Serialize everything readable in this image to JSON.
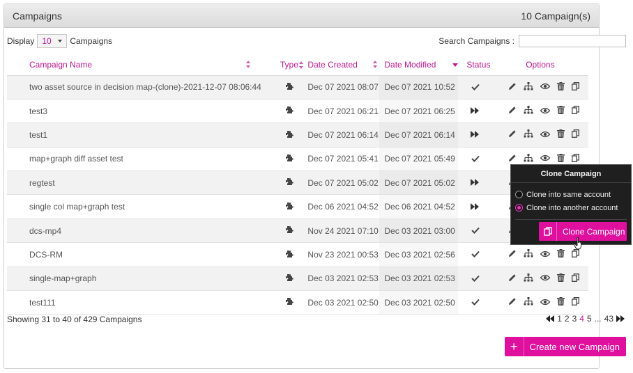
{
  "panel": {
    "title": "Campaigns",
    "count_label": "10 Campaign(s)"
  },
  "toolbar": {
    "display_label": "Display",
    "page_size": "10",
    "campaigns_label": "Campaigns",
    "search_label": "Search Campaigns :",
    "search_value": ""
  },
  "columns": {
    "name": "Campaign Name",
    "type": "Type",
    "date_created": "Date Created",
    "date_modified": "Date Modified",
    "status": "Status",
    "options": "Options"
  },
  "rows": [
    {
      "name": "two asset source in decision map-(clone)-2021-12-07 08:06:44",
      "created": "Dec 07 2021 08:07",
      "modified": "Dec 07 2021 10:52",
      "status": "check-icon"
    },
    {
      "name": "test3",
      "created": "Dec 07 2021 06:21",
      "modified": "Dec 07 2021 06:25",
      "status": "fast-forward-icon"
    },
    {
      "name": "test1",
      "created": "Dec 07 2021 06:14",
      "modified": "Dec 07 2021 06:14",
      "status": "fast-forward-icon"
    },
    {
      "name": "map+graph diff asset test",
      "created": "Dec 07 2021 05:41",
      "modified": "Dec 07 2021 05:49",
      "status": "check-icon"
    },
    {
      "name": "regtest",
      "created": "Dec 07 2021 05:02",
      "modified": "Dec 07 2021 05:02",
      "status": "fast-forward-icon"
    },
    {
      "name": "single col map+graph test",
      "created": "Dec 06 2021 04:52",
      "modified": "Dec 06 2021 04:52",
      "status": "fast-forward-icon"
    },
    {
      "name": "dcs-mp4",
      "created": "Nov 24 2021 07:10",
      "modified": "Dec 03 2021 03:00",
      "status": "check-icon"
    },
    {
      "name": "DCS-RM",
      "created": "Nov 23 2021 00:53",
      "modified": "Dec 03 2021 02:56",
      "status": "check-icon"
    },
    {
      "name": "single-map+graph",
      "created": "Dec 03 2021 02:53",
      "modified": "Dec 03 2021 02:53",
      "status": "check-icon"
    },
    {
      "name": "test111",
      "created": "Dec 03 2021 02:50",
      "modified": "Dec 03 2021 02:50",
      "status": "check-icon"
    }
  ],
  "footer": {
    "showing": "Showing 31 to 40 of 429 Campaigns"
  },
  "pagination": {
    "pages": [
      "1",
      "2",
      "3",
      "4",
      "5"
    ],
    "active": "4",
    "ellipsis": "...",
    "last": "43"
  },
  "create_button": {
    "label": "Create new Campaign"
  },
  "clone_popover": {
    "title": "Clone Campaign",
    "option_same": "Clone into same account",
    "option_other": "Clone into another account",
    "selected": "option_other",
    "button_label": "Clone Campaign"
  },
  "colors": {
    "accent": "#e0109f",
    "link": "#c2188f"
  }
}
